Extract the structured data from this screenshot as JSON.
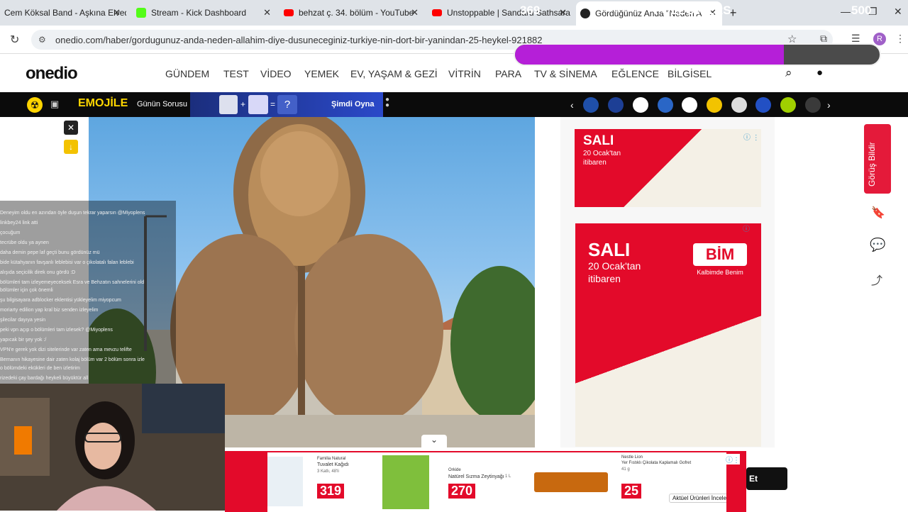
{
  "tabs": [
    {
      "title": "Cem Köksal Band - Aşkına Elveda",
      "color": "#c00"
    },
    {
      "title": "Stream - Kick Dashboard",
      "color": "#53fc18"
    },
    {
      "title": "behzat ç. 34. bölüm - YouTube",
      "color": "#f00"
    },
    {
      "title": "Unstoppable | Sandaru Sathsara",
      "color": "#f00"
    },
    {
      "title": "Gördüğünüz Anda \"Neden Allah",
      "color": "#222"
    }
  ],
  "address": {
    "url": "onedio.com/haber/gordugunuz-anda-neden-allahim-diye-dusuneceginiz-turkiye-nin-dort-bir-yanindan-25-heykel-921882"
  },
  "followers": {
    "current": "369",
    "label": "FOLLOWERS",
    "goal": "500",
    "progress": 0.738
  },
  "site": {
    "logo": "onedio",
    "nav": [
      "GÜNDEM",
      "TEST",
      "VİDEO",
      "YEMEK",
      "EV, YAŞAM & GEZİ",
      "VİTRİN",
      "PARA",
      "TV & SİNEMA",
      "EĞLENCE",
      "BİLGİSEL"
    ]
  },
  "strip": {
    "emojile": "EMOJİLE",
    "question": "Günün Sorusu",
    "equals": "=",
    "plus": "+",
    "qmark": "?",
    "play": "Şimdi Oyna"
  },
  "ads": {
    "ad1": {
      "day": "SALI",
      "date": "20 Ocak'tan",
      "since": "itibaren"
    },
    "ad2": {
      "day": "SALI",
      "date": "20 Ocak'tan",
      "since": "itibaren",
      "brand": "BİM",
      "tagline": "Kalbimde Benim"
    }
  },
  "side": {
    "feedback": "Görüş Bildir"
  },
  "bottom_ad": {
    "items": [
      {
        "brand": "Familia Natural",
        "name": "Tuvalet Kağıdı",
        "detail": "3 Katlı, 48'li",
        "price": "319"
      },
      {
        "brand": "Orkide",
        "name": "Natürel Sızma Zeytinyağı",
        "detail": "1 L",
        "price": "270"
      },
      {
        "brand": "Nestle Lion",
        "name": "Yer Fıstıklı Çikolata Kaplamalı Gofret",
        "detail": "41 g",
        "price": "25"
      }
    ],
    "cta": "Aktüel Ürünleri İncele",
    "button": "Et"
  },
  "chat": [
    "Deneyim oldu en azından öyle duşun tekrar yaparsın @Miyoplens",
    "linkbey24 link atti",
    "çocuğum",
    "tecrübe oldu ya aynen",
    "daha demin pepe laf geçti bunu gördünüz mü",
    "bide kütahyanın favşanlı leblebisi var o çikolatalı falan leblebi",
    "alışıda seçicilik direk onu gördü :D",
    "bölümleri tam izleyemeyeceksek Esra ve Behzatın sahnelerini old",
    "bölümler için çok önemli",
    "şu bilgisayara adblocker eklentisi yükleyelim miyopcum",
    "moriarty edilion yap kral biz senden izleyelim",
    "şilecilar dayıya yesin",
    "peki vpn açıp o bölümleri tam izlesek? @Miyoplens",
    "yapıcak bir şey yok :/",
    "VPN'e gerek yok dizi sitelerinde var zaten ama mevzu telifte",
    "Bernanın hikayesine dair zaten kolaj bölüm var 2 bölüm sonra izle",
    "o bölümdeki ekükleri de ben izletirim",
    "rizedeki çay bardağı heykeli büyüktür all"
  ]
}
